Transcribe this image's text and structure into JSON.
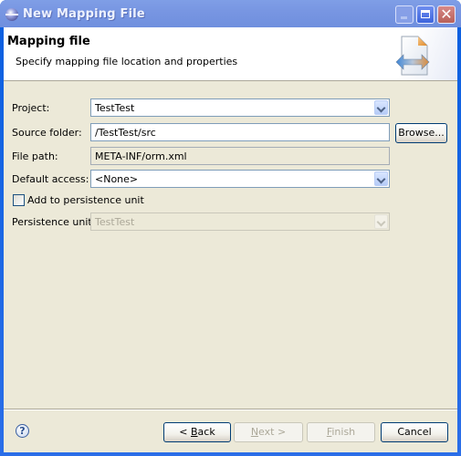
{
  "window": {
    "title": "New Mapping File",
    "controls": {
      "minimize": "minimize",
      "maximize": "maximize",
      "close": "✕"
    }
  },
  "header": {
    "title": "Mapping file",
    "description": "Specify mapping file location and properties",
    "icon": "mapping-file-wizard-icon"
  },
  "form": {
    "project": {
      "label": "Project:",
      "value": "TestTest"
    },
    "source_folder": {
      "label": "Source folder:",
      "value": "/TestTest/src",
      "browse_label": "Browse..."
    },
    "file_path": {
      "label": "File path:",
      "value": "META-INF/orm.xml"
    },
    "default_access": {
      "label": "Default access:",
      "value": "<None>"
    },
    "add_to_persistence": {
      "label": "Add to persistence unit",
      "checked": false
    },
    "persistence_unit": {
      "label": "Persistence unit:",
      "value": "TestTest",
      "enabled": false
    }
  },
  "footer": {
    "help_icon": "?",
    "back_prefix": "< ",
    "back_mnemonic": "B",
    "back_rest": "ack",
    "next_mnemonic": "N",
    "next_rest": "ext >",
    "finish_mnemonic": "F",
    "finish_rest": "inish",
    "cancel_label": "Cancel"
  }
}
